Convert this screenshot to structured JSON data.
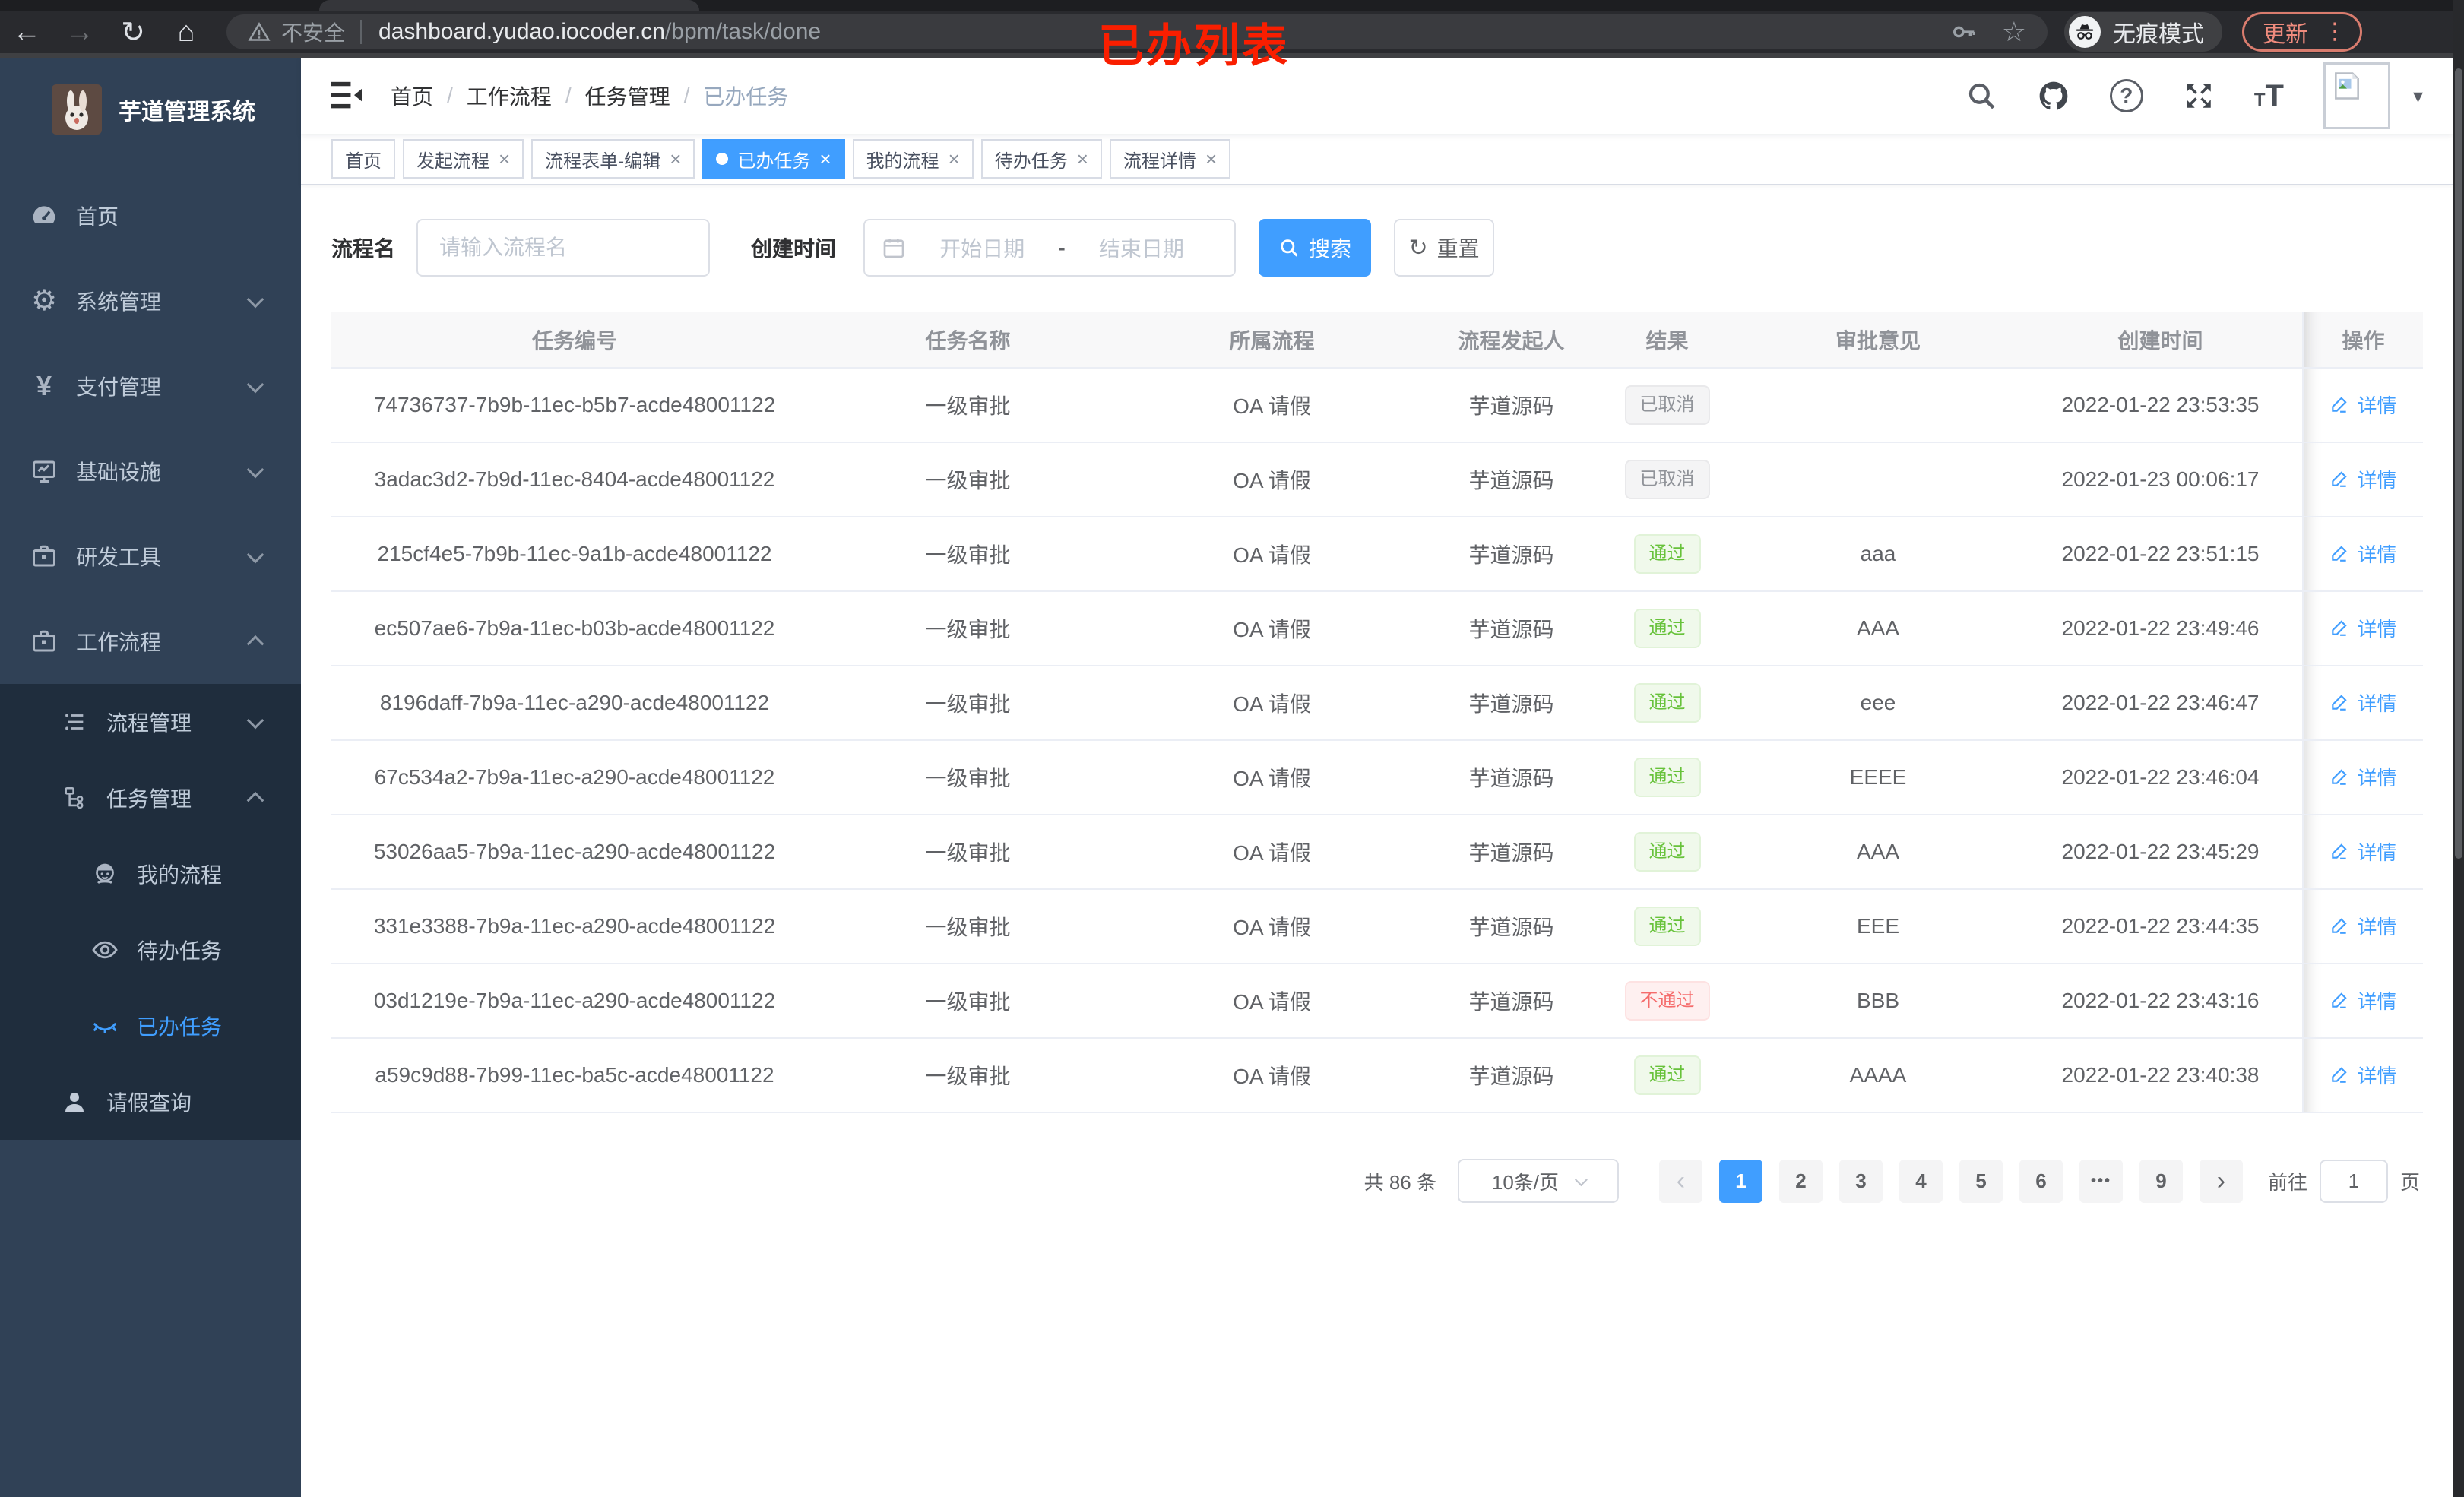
{
  "browser": {
    "security_label": "不安全",
    "url_host": "dashboard.yudao.iocoder.cn",
    "url_path": "/bpm/task/done",
    "incognito_label": "无痕模式",
    "update_label": "更新",
    "back_glyph": "←",
    "forward_glyph": "→",
    "reload_glyph": "↻",
    "home_glyph": "⌂",
    "star_glyph": "☆",
    "menu_dots": "⋮"
  },
  "annotation": {
    "text": "已办列表",
    "color": "#f91e00"
  },
  "sidebar": {
    "logo_title": "芋道管理系统",
    "items": [
      {
        "label": "首页"
      },
      {
        "label": "系统管理"
      },
      {
        "label": "支付管理"
      },
      {
        "label": "基础设施"
      },
      {
        "label": "研发工具"
      },
      {
        "label": "工作流程"
      }
    ],
    "workflow_children": [
      {
        "label": "流程管理"
      },
      {
        "label": "任务管理"
      },
      {
        "label": "我的流程"
      },
      {
        "label": "待办任务"
      },
      {
        "label": "已办任务"
      },
      {
        "label": "请假查询"
      }
    ],
    "active_item": "已办任务",
    "active_color": "#409eff"
  },
  "header": {
    "breadcrumb": [
      "首页",
      "工作流程",
      "任务管理",
      "已办任务"
    ],
    "separator": "/"
  },
  "tabs": [
    {
      "label": "首页",
      "closable": false,
      "active": false
    },
    {
      "label": "发起流程",
      "closable": true,
      "active": false
    },
    {
      "label": "流程表单-编辑",
      "closable": true,
      "active": false
    },
    {
      "label": "已办任务",
      "closable": true,
      "active": true
    },
    {
      "label": "我的流程",
      "closable": true,
      "active": false
    },
    {
      "label": "待办任务",
      "closable": true,
      "active": false
    },
    {
      "label": "流程详情",
      "closable": true,
      "active": false
    }
  ],
  "filters": {
    "name_label": "流程名",
    "name_placeholder": "请输入流程名",
    "time_label": "创建时间",
    "start_placeholder": "开始日期",
    "range_separator": "-",
    "end_placeholder": "结束日期",
    "search_label": "搜索",
    "reset_label": "重置"
  },
  "table": {
    "columns": [
      "任务编号",
      "任务名称",
      "所属流程",
      "流程发起人",
      "结果",
      "审批意见",
      "创建时间",
      "操作"
    ],
    "action_label": "详情",
    "rows": [
      {
        "id": "74736737-7b9b-11ec-b5b7-acde48001122",
        "name": "一级审批",
        "process": "OA 请假",
        "starter": "芋道源码",
        "result": "已取消",
        "result_type": "info",
        "comment": "",
        "created": "2022-01-22 23:53:35"
      },
      {
        "id": "3adac3d2-7b9d-11ec-8404-acde48001122",
        "name": "一级审批",
        "process": "OA 请假",
        "starter": "芋道源码",
        "result": "已取消",
        "result_type": "info",
        "comment": "",
        "created": "2022-01-23 00:06:17"
      },
      {
        "id": "215cf4e5-7b9b-11ec-9a1b-acde48001122",
        "name": "一级审批",
        "process": "OA 请假",
        "starter": "芋道源码",
        "result": "通过",
        "result_type": "success",
        "comment": "aaa",
        "created": "2022-01-22 23:51:15"
      },
      {
        "id": "ec507ae6-7b9a-11ec-b03b-acde48001122",
        "name": "一级审批",
        "process": "OA 请假",
        "starter": "芋道源码",
        "result": "通过",
        "result_type": "success",
        "comment": "AAA",
        "created": "2022-01-22 23:49:46"
      },
      {
        "id": "8196daff-7b9a-11ec-a290-acde48001122",
        "name": "一级审批",
        "process": "OA 请假",
        "starter": "芋道源码",
        "result": "通过",
        "result_type": "success",
        "comment": "eee",
        "created": "2022-01-22 23:46:47"
      },
      {
        "id": "67c534a2-7b9a-11ec-a290-acde48001122",
        "name": "一级审批",
        "process": "OA 请假",
        "starter": "芋道源码",
        "result": "通过",
        "result_type": "success",
        "comment": "EEEE",
        "created": "2022-01-22 23:46:04"
      },
      {
        "id": "53026aa5-7b9a-11ec-a290-acde48001122",
        "name": "一级审批",
        "process": "OA 请假",
        "starter": "芋道源码",
        "result": "通过",
        "result_type": "success",
        "comment": "AAA",
        "created": "2022-01-22 23:45:29"
      },
      {
        "id": "331e3388-7b9a-11ec-a290-acde48001122",
        "name": "一级审批",
        "process": "OA 请假",
        "starter": "芋道源码",
        "result": "通过",
        "result_type": "success",
        "comment": "EEE",
        "created": "2022-01-22 23:44:35"
      },
      {
        "id": "03d1219e-7b9a-11ec-a290-acde48001122",
        "name": "一级审批",
        "process": "OA 请假",
        "starter": "芋道源码",
        "result": "不通过",
        "result_type": "danger",
        "comment": "BBB",
        "created": "2022-01-22 23:43:16"
      },
      {
        "id": "a59c9d88-7b99-11ec-ba5c-acde48001122",
        "name": "一级审批",
        "process": "OA 请假",
        "starter": "芋道源码",
        "result": "通过",
        "result_type": "success",
        "comment": "AAAA",
        "created": "2022-01-22 23:40:38"
      }
    ]
  },
  "pagination": {
    "total_text": "共 86 条",
    "page_size": "10条/页",
    "prev_glyph": "‹",
    "next_glyph": "›",
    "pages": [
      "1",
      "2",
      "3",
      "4",
      "5",
      "6",
      "•••",
      "9"
    ],
    "active_page": "1",
    "goto_label": "前往",
    "goto_value": "1",
    "goto_suffix": "页"
  },
  "colors": {
    "accent": "#409eff",
    "success": "#67c23a",
    "danger": "#f56c6c",
    "info": "#909399",
    "sidebar_bg": "#304156",
    "submenu_bg": "#1f2d3d"
  }
}
